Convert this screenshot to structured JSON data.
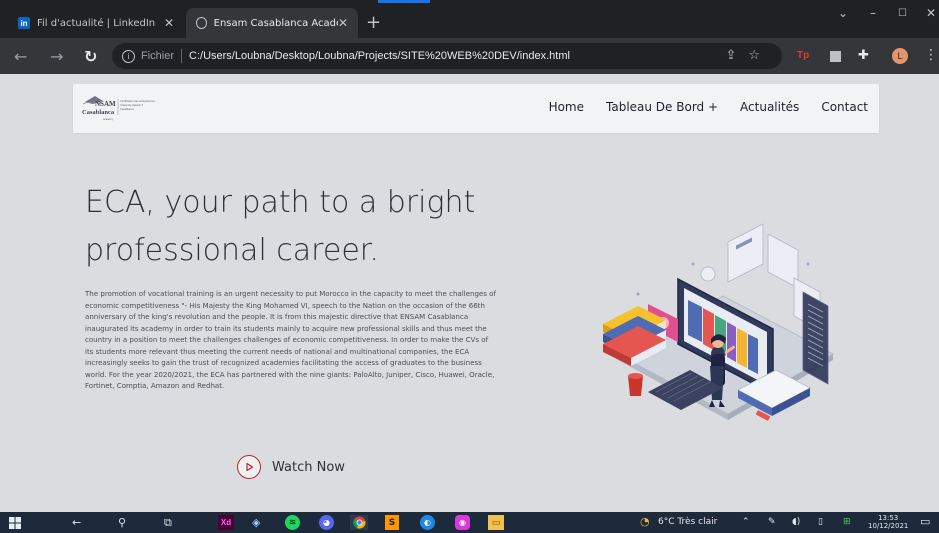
{
  "browser": {
    "tabs": [
      {
        "label": "Fil d'actualité | LinkedIn",
        "favicon": "linkedin-icon",
        "active": false
      },
      {
        "label": "Ensam Casablanca Academy",
        "favicon": "globe-icon",
        "active": true
      }
    ],
    "new_tab": "+",
    "window_controls": [
      "⌄",
      "–",
      "☐",
      "✕"
    ],
    "address": {
      "prefix": "Fichier",
      "url": "C:/Users/Loubna/Desktop/Loubna/Projects/SITE%20WEB%20DEV/index.html"
    },
    "profile_initial": "L",
    "extension_label": "Tp"
  },
  "site": {
    "logo": {
      "name_line1": "NSAM",
      "name_line2": "Casablanca",
      "sub": "Academy",
      "tagline": [
        "Certification des compétences",
        "University Hassan II",
        "Casablanca"
      ]
    },
    "nav": [
      {
        "label": "Home"
      },
      {
        "label": "Tableau De Bord +"
      },
      {
        "label": "Actualités"
      },
      {
        "label": "Contact"
      }
    ],
    "hero": {
      "title": "ECA, your path to a bright professional career.",
      "paragraph": "The promotion of vocational training is an urgent necessity to put Morocco in the capacity to meet the challenges of economic competitiveness \"- His Majesty the King Mohamed VI, speech to the Nation on the occasion of the 66th anniversary of the king's revolution and the people. It is from this majestic directive that ENSAM Casablanca inaugurated its academy in order to train its students mainly to acquire new professional skills and thus meet the country in a position to meet the challenges challenges of economic competitiveness. In order to make the CVs of its students more relevant thus meeting the current needs of national and multinational companies, the ECA increasingly seeks to gain the trust of recognized academies facilitating the access of graduates to the business world. For the year 2020/2021, the ECA has partnered with the nine giants: PaloAlto, Juniper, Cisco, Huawei, Oracle, Fortinet, Comptia, Amazon and Redhat.",
      "cta": "Watch Now"
    }
  },
  "taskbar": {
    "weather": "6°C  Très clair",
    "time": "13:53",
    "date": "10/12/2021",
    "app_icons": [
      "windows-start-icon",
      "back-arrow-icon",
      "search-icon",
      "task-view-icon",
      "adobe-xd-icon",
      "3d-box-icon",
      "spotify-icon",
      "discord-icon",
      "chrome-icon",
      "sublime-icon",
      "edge-icon",
      "screen-recorder-icon",
      "file-explorer-icon"
    ]
  },
  "colors": {
    "chrome_dark": "#202124",
    "toolbar": "#35363a",
    "page_bg": "#dadcdf",
    "navbar_bg": "#f2f3f5",
    "accent_red": "#b9252b",
    "taskbar": "#1c2a3b"
  }
}
